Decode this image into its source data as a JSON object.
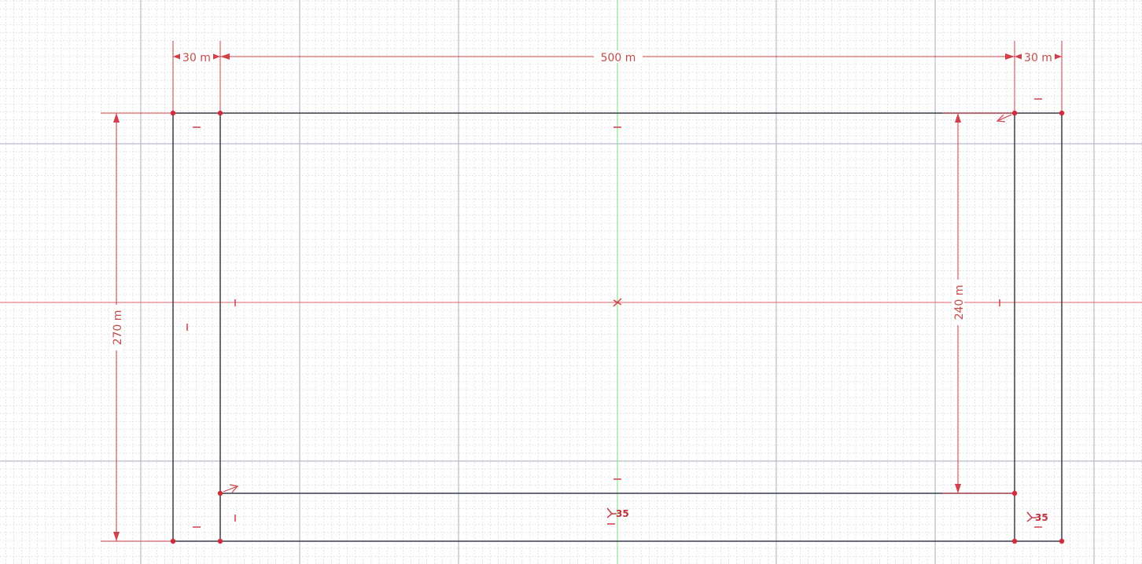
{
  "view": {
    "name": "sketch-canvas",
    "colors": {
      "background": "#ffffff",
      "minor_grid": "#d4d7de",
      "major_grid": "#b8bccb",
      "h_axis": "#e06070",
      "v_axis": "#7ee07e",
      "geometry": "#3a3f4a",
      "dimension": "#d2404a",
      "point": "#d22c3c"
    }
  },
  "dimensions": {
    "top_left_width": "30 m",
    "top_center_width": "500 m",
    "top_right_width": "30 m",
    "left_height": "270 m",
    "right_height": "240 m"
  },
  "constraints": {
    "bottom_center_angle": "35",
    "bottom_right_angle": "35"
  }
}
